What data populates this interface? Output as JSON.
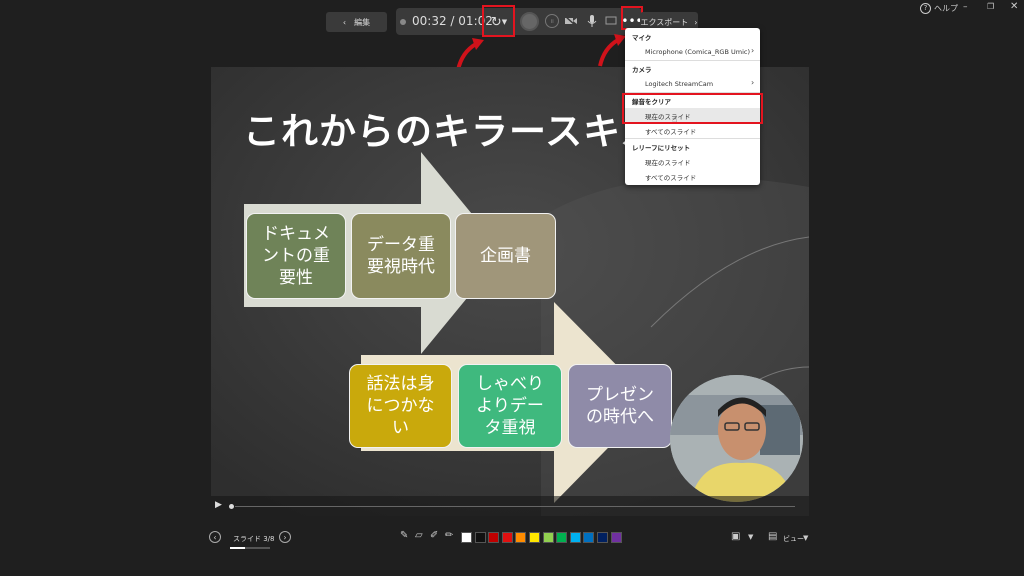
{
  "top_right": {
    "help_label": "ヘルプ",
    "help_icon": "question-circle-icon",
    "min_icon": "minimize-icon",
    "restore_icon": "restore-icon",
    "close_icon": "close-icon"
  },
  "toolbar": {
    "edit_label": "編集",
    "time_current": "00:32",
    "time_sep": "/",
    "time_total": "01:02",
    "export_label": "エクスポート"
  },
  "menu": {
    "mic_header": "マイク",
    "mic_device": "Microphone (Comica_RGB Umic)",
    "camera_header": "カメラ",
    "camera_device": "Logitech StreamCam",
    "clear_header": "録音をクリア",
    "clear_current": "現在のスライド",
    "clear_all": "すべてのスライド",
    "reset_header": "レリーフにリセット",
    "reset_current": "現在のスライド",
    "reset_all": "すべてのスライド"
  },
  "slide": {
    "title": "これからのキラースキル",
    "boxes_top": [
      "ドキュメントの重要性",
      "データ重要視時代",
      "企画書"
    ],
    "boxes_bottom": [
      "話法は身につかない",
      "しゃべりよりデータ重視",
      "プレゼンの時代へ"
    ],
    "box_lines": {
      "b1": [
        "ドキュメ",
        "ントの重",
        "要性"
      ],
      "b2": [
        "データ重",
        "要視時代"
      ],
      "b3": [
        "企画書"
      ],
      "b4": [
        "話法は身",
        "につかな",
        "い"
      ],
      "b5": [
        "しゃべり",
        "よりデー",
        "タ重視"
      ],
      "b6": [
        "プレゼン",
        "の時代へ"
      ]
    },
    "colors": {
      "olive": "#6f8358",
      "khaki": "#8a8a5e",
      "tan": "#a0967a",
      "gold": "#c9a90c",
      "green": "#3fb97e",
      "lavender": "#8f8ba8"
    }
  },
  "bottom": {
    "slide_label": "スライド 3/8",
    "view_label": "ビュー",
    "colors": [
      "#ffffff",
      "#111111",
      "#c00000",
      "#e01010",
      "#ff8c00",
      "#ffe600",
      "#92d050",
      "#00b050",
      "#00b0f0",
      "#0070c0",
      "#002060",
      "#7030a0"
    ]
  }
}
